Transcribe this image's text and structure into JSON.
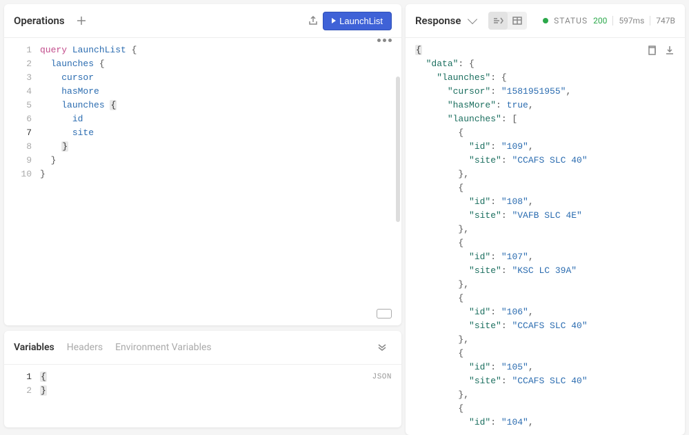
{
  "operations": {
    "title": "Operations",
    "run_label": "LaunchList",
    "lines": [
      {
        "n": 1,
        "tokens": [
          {
            "t": "query ",
            "c": "kw"
          },
          {
            "t": "LaunchList",
            "c": "fn"
          },
          {
            "t": " {",
            "c": "brace"
          }
        ]
      },
      {
        "n": 2,
        "tokens": [
          {
            "t": "  ",
            "c": ""
          },
          {
            "t": "launches",
            "c": "field"
          },
          {
            "t": " {",
            "c": "brace"
          }
        ]
      },
      {
        "n": 3,
        "tokens": [
          {
            "t": "    ",
            "c": ""
          },
          {
            "t": "cursor",
            "c": "field"
          }
        ]
      },
      {
        "n": 4,
        "tokens": [
          {
            "t": "    ",
            "c": ""
          },
          {
            "t": "hasMore",
            "c": "field"
          }
        ]
      },
      {
        "n": 5,
        "tokens": [
          {
            "t": "    ",
            "c": ""
          },
          {
            "t": "launches",
            "c": "field"
          },
          {
            "t": " ",
            "c": ""
          },
          {
            "t": "{",
            "c": "brace-hl"
          }
        ]
      },
      {
        "n": 6,
        "tokens": [
          {
            "t": "      ",
            "c": ""
          },
          {
            "t": "id",
            "c": "field"
          }
        ]
      },
      {
        "n": 7,
        "tokens": [
          {
            "t": "      ",
            "c": ""
          },
          {
            "t": "site",
            "c": "field"
          }
        ],
        "active": true
      },
      {
        "n": 8,
        "tokens": [
          {
            "t": "    ",
            "c": ""
          },
          {
            "t": "}",
            "c": "brace-hl"
          }
        ]
      },
      {
        "n": 9,
        "tokens": [
          {
            "t": "  ",
            "c": ""
          },
          {
            "t": "}",
            "c": "brace"
          }
        ]
      },
      {
        "n": 10,
        "tokens": [
          {
            "t": "}",
            "c": "brace"
          }
        ]
      }
    ]
  },
  "variables": {
    "tabs": [
      "Variables",
      "Headers",
      "Environment Variables"
    ],
    "active_tab": 0,
    "json_label": "JSON",
    "lines": [
      {
        "n": 1,
        "tokens": [
          {
            "t": "{",
            "c": "brace-hl"
          }
        ],
        "active": true
      },
      {
        "n": 2,
        "tokens": [
          {
            "t": "}",
            "c": "brace-hl"
          }
        ]
      }
    ]
  },
  "response": {
    "title": "Response",
    "status_label": "STATUS",
    "status_code": "200",
    "time": "597ms",
    "size": "747B",
    "json": {
      "data": {
        "launches": {
          "cursor": "1581951955",
          "hasMore": true,
          "launches": [
            {
              "id": "109",
              "site": "CCAFS SLC 40"
            },
            {
              "id": "108",
              "site": "VAFB SLC 4E"
            },
            {
              "id": "107",
              "site": "KSC LC 39A"
            },
            {
              "id": "106",
              "site": "CCAFS SLC 40"
            },
            {
              "id": "105",
              "site": "CCAFS SLC 40"
            },
            {
              "id": "104"
            }
          ]
        }
      }
    }
  }
}
